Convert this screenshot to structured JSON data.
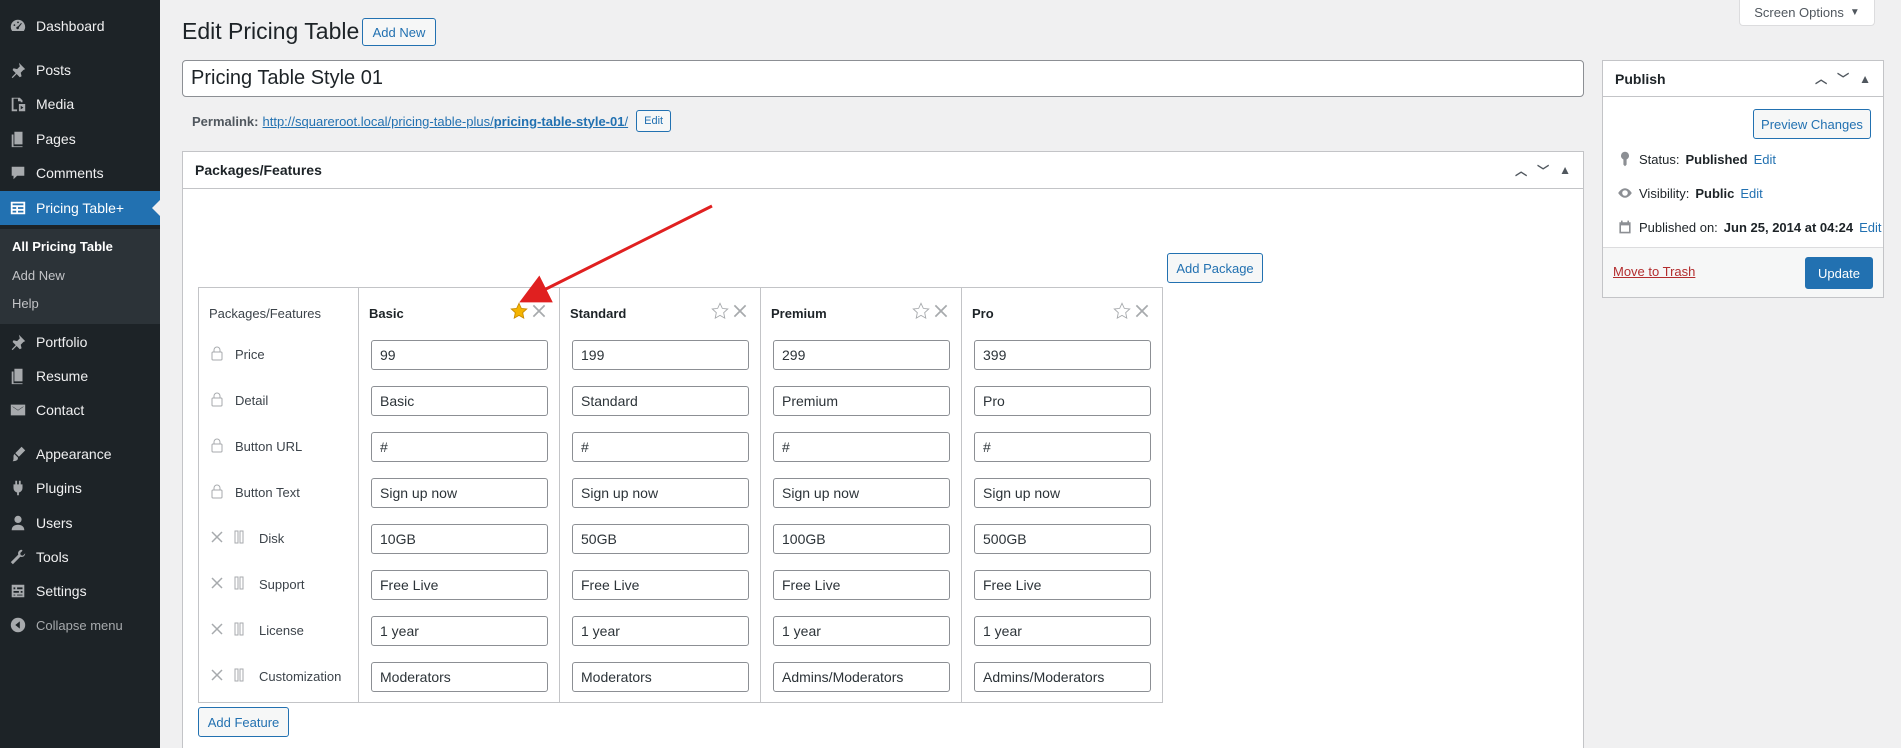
{
  "sidebar": {
    "items": [
      {
        "label": "Dashboard",
        "icon": "dashboard-icon"
      },
      {
        "label": "Posts",
        "icon": "pin-icon"
      },
      {
        "label": "Media",
        "icon": "media-icon"
      },
      {
        "label": "Pages",
        "icon": "pages-icon"
      },
      {
        "label": "Comments",
        "icon": "comment-icon"
      },
      {
        "label": "Pricing Table+",
        "icon": "table-icon"
      },
      {
        "label": "Portfolio",
        "icon": "pin-icon"
      },
      {
        "label": "Resume",
        "icon": "pages-icon"
      },
      {
        "label": "Contact",
        "icon": "mail-icon"
      },
      {
        "label": "Appearance",
        "icon": "brush-icon"
      },
      {
        "label": "Plugins",
        "icon": "plugin-icon"
      },
      {
        "label": "Users",
        "icon": "user-icon"
      },
      {
        "label": "Tools",
        "icon": "wrench-icon"
      },
      {
        "label": "Settings",
        "icon": "settings-icon"
      },
      {
        "label": "Collapse menu",
        "icon": "collapse-icon"
      }
    ],
    "submenu": [
      "All Pricing Table",
      "Add New",
      "Help"
    ]
  },
  "header": {
    "title": "Edit Pricing Table",
    "add_new": "Add New",
    "screen_options": "Screen Options"
  },
  "post": {
    "title": "Pricing Table Style 01",
    "permalink_label": "Permalink:",
    "permalink_base": "http://squareroot.local/pricing-table-plus/",
    "permalink_slug": "pricing-table-style-01",
    "permalink_end": "/",
    "permalink_edit": "Edit"
  },
  "packages_box": {
    "title": "Packages/Features",
    "add_package": "Add Package",
    "add_feature": "Add Feature",
    "features_header": "Packages/Features",
    "features": [
      {
        "name": "Price",
        "locked": true
      },
      {
        "name": "Detail",
        "locked": true
      },
      {
        "name": "Button URL",
        "locked": true
      },
      {
        "name": "Button Text",
        "locked": true
      },
      {
        "name": "Disk",
        "locked": false
      },
      {
        "name": "Support",
        "locked": false
      },
      {
        "name": "License",
        "locked": false
      },
      {
        "name": "Customization",
        "locked": false
      }
    ],
    "packages": [
      {
        "name": "Basic",
        "featured": true,
        "values": [
          "99",
          "Basic",
          "#",
          "Sign up now",
          "10GB",
          "Free Live",
          "1 year",
          "Moderators"
        ]
      },
      {
        "name": "Standard",
        "featured": false,
        "values": [
          "199",
          "Standard",
          "#",
          "Sign up now",
          "50GB",
          "Free Live",
          "1 year",
          "Moderators"
        ]
      },
      {
        "name": "Premium",
        "featured": false,
        "values": [
          "299",
          "Premium",
          "#",
          "Sign up now",
          "100GB",
          "Free Live",
          "1 year",
          "Admins/Moderators"
        ]
      },
      {
        "name": "Pro",
        "featured": false,
        "values": [
          "399",
          "Pro",
          "#",
          "Sign up now",
          "500GB",
          "Free Live",
          "1 year",
          "Admins/Moderators"
        ]
      }
    ]
  },
  "publish": {
    "title": "Publish",
    "preview": "Preview Changes",
    "status_label": "Status:",
    "status_value": "Published",
    "visibility_label": "Visibility:",
    "visibility_value": "Public",
    "published_label": "Published on:",
    "published_value": "Jun 25, 2014 at 04:24",
    "edit": "Edit",
    "trash": "Move to Trash",
    "update": "Update"
  },
  "colors": {
    "accent": "#2271b1",
    "sidebar_bg": "#1d2327",
    "annotation_arrow": "#e02020",
    "star": "#f5b400"
  }
}
